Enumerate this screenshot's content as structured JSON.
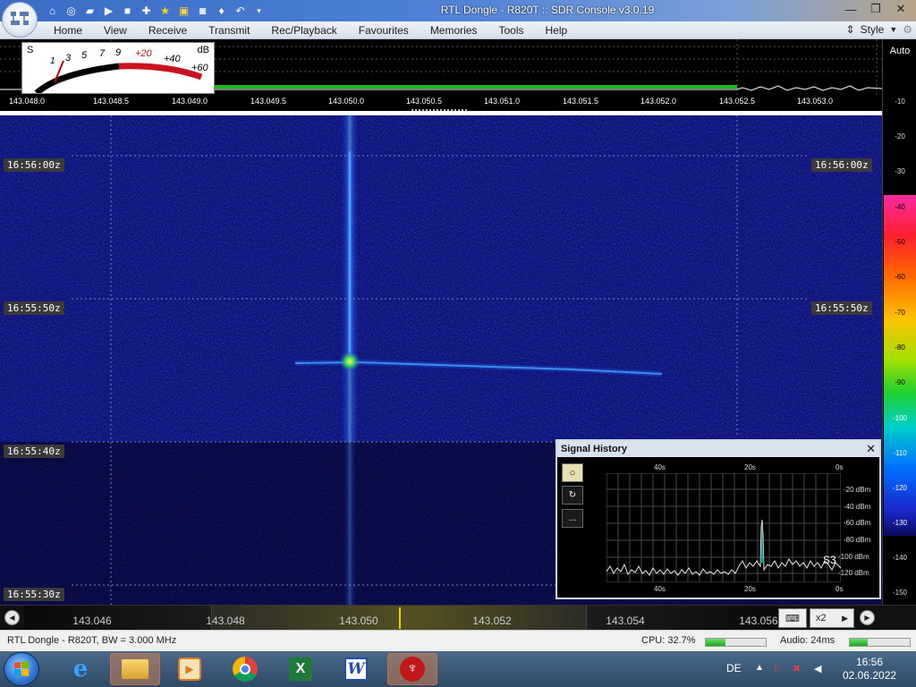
{
  "window": {
    "title": "RTL Dongle - R820T :: SDR Console v3.0.19",
    "minimize": "—",
    "restore": "❐",
    "close": "✕"
  },
  "menu": {
    "items": [
      "Home",
      "View",
      "Receive",
      "Transmit",
      "Rec/Playback",
      "Favourites",
      "Memories",
      "Tools",
      "Help"
    ],
    "style_label": "Style"
  },
  "meter": {
    "s_label": "S",
    "db_label": "dB",
    "s_units": [
      "1",
      "3",
      "5",
      "7",
      "9"
    ],
    "plus_db": [
      "+20",
      "+40",
      "+60"
    ]
  },
  "spectrum": {
    "freq_ticks": [
      "143.048.0",
      "143.048.5",
      "143.049.0",
      "143.049.5",
      "143.050.0",
      "143.050.5",
      "143.051.0",
      "143.051.5",
      "143.052.0",
      "143.052.5",
      "143.053.0"
    ]
  },
  "db_scale": {
    "auto": "Auto",
    "upper_ticks": [
      "-10",
      "-20",
      "-30"
    ],
    "colorbar_ticks": [
      "-40",
      "-50",
      "-60",
      "-70",
      "-80",
      "-90",
      "-100",
      "-110",
      "-120",
      "-130"
    ],
    "lower_ticks": [
      "-140",
      "-150"
    ]
  },
  "waterfall": {
    "times": [
      "16:56:00z",
      "16:55:50z",
      "16:55:40z",
      "16:55:30z"
    ]
  },
  "signal_history": {
    "title": "Signal History",
    "close": "✕",
    "top_axis": [
      "40s",
      "20s",
      "0s"
    ],
    "bottom_axis": [
      "40s",
      "20s",
      "0s"
    ],
    "dbm_ticks": [
      "-20 dBm",
      "-40 dBm",
      "-60 dBm",
      "-80 dBm",
      "-100 dBm",
      "-120 dBm"
    ],
    "s_value": "S3",
    "btn_more": "..."
  },
  "bottom_bar": {
    "freqs": [
      "143.046",
      "143.048",
      "143.050",
      "143.052",
      "143.054",
      "143.056"
    ],
    "zoom": "x2"
  },
  "status": {
    "device": "RTL Dongle - R820T, BW = 3.000 MHz",
    "cpu": "CPU: 32.7%",
    "cpu_percent": 32.7,
    "audio": "Audio: 24ms",
    "audio_percent": 30
  },
  "taskbar": {
    "language": "DE",
    "time": "16:56",
    "date": "02.06.2022"
  }
}
